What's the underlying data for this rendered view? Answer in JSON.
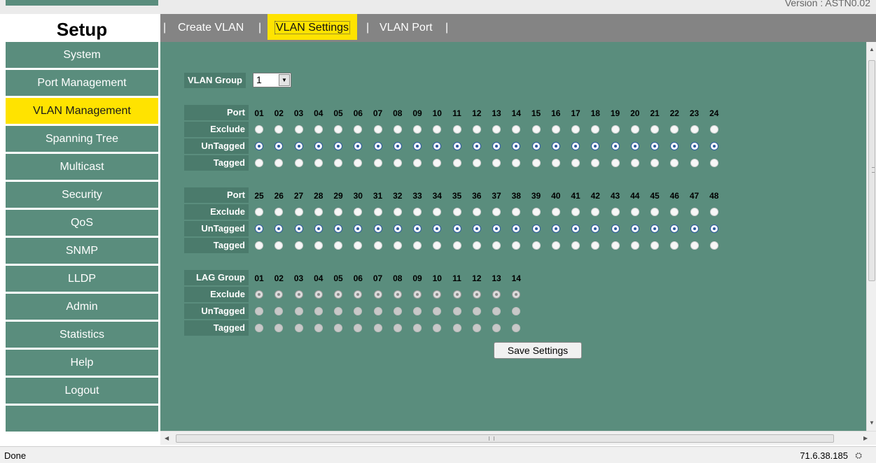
{
  "app": {
    "version": "Version : ASTN0.02"
  },
  "sidebar": {
    "title": "Setup",
    "items": [
      {
        "label": "System"
      },
      {
        "label": "Port Management"
      },
      {
        "label": "VLAN Management"
      },
      {
        "label": "Spanning Tree"
      },
      {
        "label": "Multicast"
      },
      {
        "label": "Security"
      },
      {
        "label": "QoS"
      },
      {
        "label": "SNMP"
      },
      {
        "label": "LLDP"
      },
      {
        "label": "Admin"
      },
      {
        "label": "Statistics"
      },
      {
        "label": "Help"
      },
      {
        "label": "Logout"
      }
    ],
    "active_item": "VLAN Management"
  },
  "tabs": {
    "separator": "|",
    "items": [
      {
        "label": "Create VLAN"
      },
      {
        "label": "VLAN Settings"
      },
      {
        "label": "VLAN Port"
      }
    ],
    "active_tab": "VLAN Settings"
  },
  "vlan_group": {
    "label": "VLAN Group",
    "value": "1"
  },
  "port_tables": [
    {
      "header_label": "Port",
      "ports": [
        "01",
        "02",
        "03",
        "04",
        "05",
        "06",
        "07",
        "08",
        "09",
        "10",
        "11",
        "12",
        "13",
        "14",
        "15",
        "16",
        "17",
        "18",
        "19",
        "20",
        "21",
        "22",
        "23",
        "24"
      ],
      "rows": [
        "Exclude",
        "UnTagged",
        "Tagged"
      ],
      "selected_row": "UnTagged"
    },
    {
      "header_label": "Port",
      "ports": [
        "25",
        "26",
        "27",
        "28",
        "29",
        "30",
        "31",
        "32",
        "33",
        "34",
        "35",
        "36",
        "37",
        "38",
        "39",
        "40",
        "41",
        "42",
        "43",
        "44",
        "45",
        "46",
        "47",
        "48"
      ],
      "rows": [
        "Exclude",
        "UnTagged",
        "Tagged"
      ],
      "selected_row": "UnTagged"
    },
    {
      "header_label": "LAG Group",
      "ports": [
        "01",
        "02",
        "03",
        "04",
        "05",
        "06",
        "07",
        "08",
        "09",
        "10",
        "11",
        "12",
        "13",
        "14"
      ],
      "rows": [
        "Exclude",
        "UnTagged",
        "Tagged"
      ],
      "selected_row": "Exclude"
    }
  ],
  "save_button": "Save Settings",
  "status": {
    "text": "Done",
    "ip": "71.6.38.185"
  },
  "colors": {
    "panel": "#5a8d7d",
    "label_bg": "#4b7b6c",
    "highlight": "#ffe300",
    "tabbar": "#848484"
  }
}
